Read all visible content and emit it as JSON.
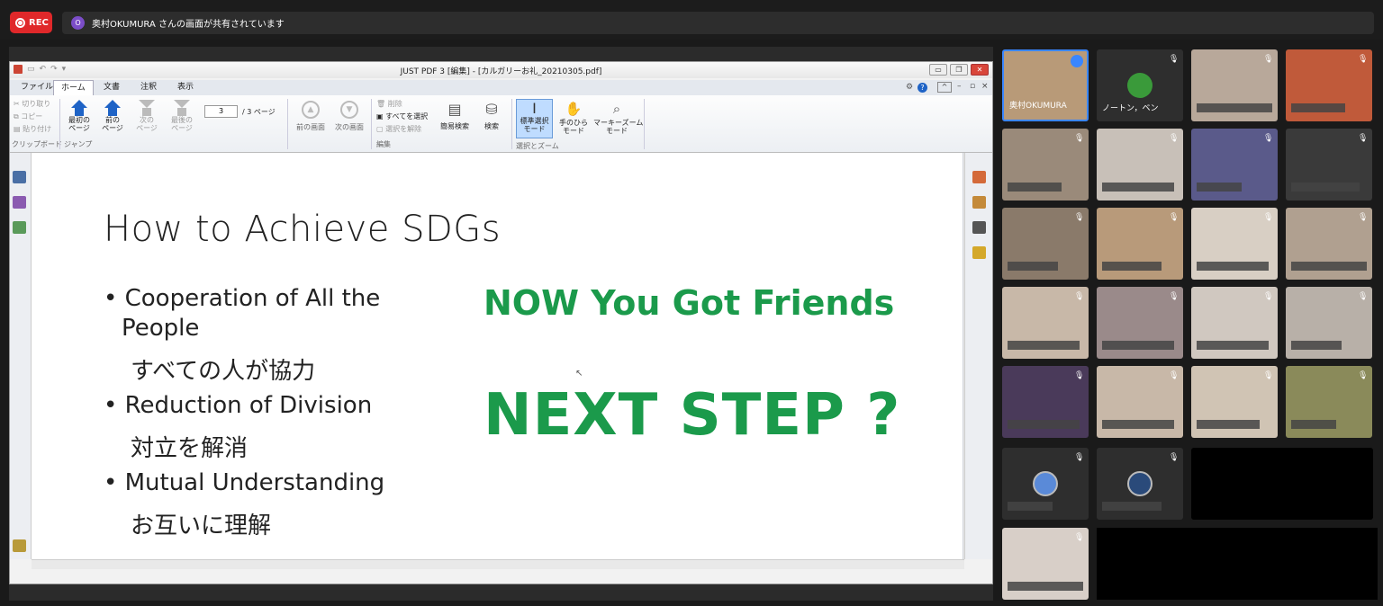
{
  "zoom_bar": {
    "rec_label": "REC",
    "presenter_initial": "O",
    "share_banner_text": "奥村OKUMURA さんの画面が共有されています"
  },
  "pdf_app": {
    "window_title": "JUST PDF 3 [編集] - [カルガリーお礼_20210305.pdf]",
    "tabs": [
      "ファイル",
      "ホーム",
      "文書",
      "注釈",
      "表示"
    ],
    "active_tab": "ホーム",
    "clipboard": {
      "cut": "切り取り",
      "copy": "コピー",
      "paste": "貼り付け",
      "group": "クリップボード"
    },
    "jump": {
      "first_page": "最初の\nページ",
      "prev_page": "前の\nページ",
      "next_page": "次の\nページ",
      "last_page": "最後の\nページ",
      "group": "ジャンプ"
    },
    "page_current": "3",
    "page_total": "/ 3 ページ",
    "view_nav": {
      "prev_view": "前の画面",
      "next_view": "次の画面"
    },
    "edit": {
      "delete": "削除",
      "select_all": "すべてを選択",
      "deselect": "選択を解除",
      "group": "編集"
    },
    "search": {
      "quick_search": "簡易検索",
      "search": "検索"
    },
    "select_zoom": {
      "standard_select": "標準選択\nモード",
      "hand": "手のひら\nモード",
      "marquee_zoom": "マーキーズーム\nモード",
      "group": "選択とズーム"
    }
  },
  "slide": {
    "title": "How to Achieve SDGs",
    "bullets": [
      {
        "en_line1": "• Cooperation of All the",
        "en_line2": "People",
        "jp": "すべての人が協力"
      },
      {
        "en_line1": "• Reduction of Division",
        "en_line2": "",
        "jp": "対立を解消"
      },
      {
        "en_line1": "• Mutual Understanding",
        "en_line2": "",
        "jp": "お互いに理解"
      }
    ],
    "headline1": "NOW You Got Friends",
    "headline2": "NEXT STEP ?"
  },
  "participants": [
    {
      "label": "奥村OKUMURA",
      "active_speaker": true
    },
    {
      "label": "ノートン，ベン"
    }
  ],
  "colors": {
    "rec_red": "#e0282a",
    "slide_green": "#1b9a4b",
    "active_speaker_border": "#3a86ff"
  }
}
